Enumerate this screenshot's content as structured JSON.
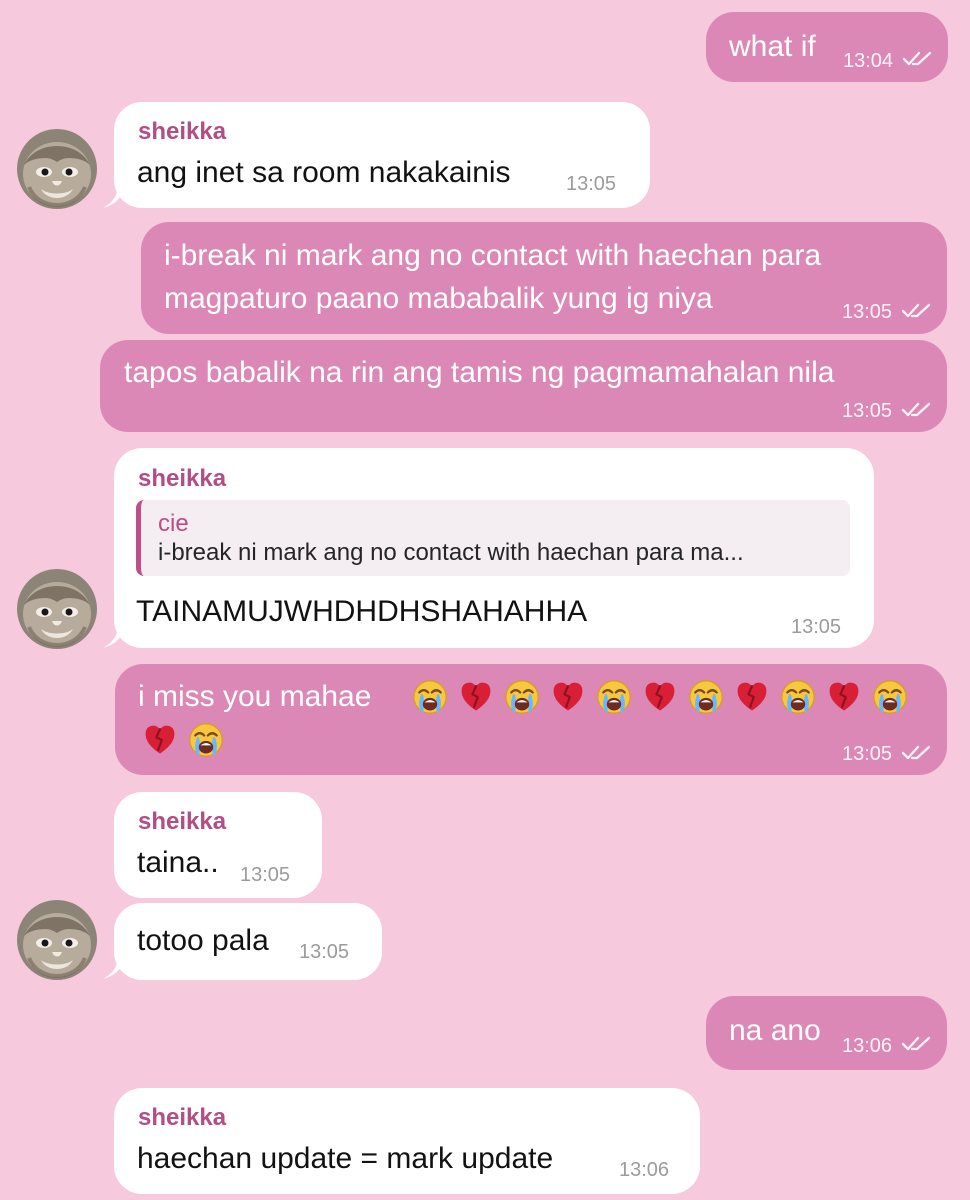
{
  "colors": {
    "background": "#f6c9dc",
    "incoming_bubble": "#ffffff",
    "outgoing_bubble": "#dc88b7",
    "sender_name": "#b24d86",
    "reply_bar": "#bf4d87"
  },
  "icons": {
    "read_receipt": "double-check-icon",
    "avatar": "profile-avatar",
    "crying_emoji": "loudly-crying-face-emoji",
    "broken_heart_emoji": "broken-heart-emoji"
  },
  "messages": [
    {
      "direction": "outgoing",
      "text": "what if",
      "time": "13:04",
      "read_receipt": "double-check-icon"
    },
    {
      "direction": "incoming",
      "sender": "sheikka",
      "text": "ang inet sa room nakakainis",
      "time": "13:05"
    },
    {
      "direction": "outgoing",
      "text_lines": [
        "i-break ni mark ang no contact with haechan para",
        "magpaturo paano mababalik yung ig niya"
      ],
      "time": "13:05",
      "read_receipt": "double-check-icon"
    },
    {
      "direction": "outgoing",
      "text": "tapos babalik na rin ang tamis ng pagmamahalan nila",
      "time": "13:05",
      "read_receipt": "double-check-icon"
    },
    {
      "direction": "incoming",
      "sender": "sheikka",
      "reply_to": {
        "name": "cie",
        "text": "i-break ni mark ang no contact with haechan para ma..."
      },
      "text": "TAINAMUJWHDHDHSHAHAHHA",
      "time": "13:05"
    },
    {
      "direction": "outgoing",
      "text": "i miss you mahae",
      "emoji_line1": [
        "sob",
        "broken_heart",
        "sob",
        "broken_heart",
        "sob",
        "broken_heart",
        "sob",
        "broken_heart",
        "sob",
        "broken_heart",
        "sob"
      ],
      "emoji_line2": [
        "broken_heart",
        "sob"
      ],
      "time": "13:05",
      "read_receipt": "double-check-icon"
    },
    {
      "direction": "incoming",
      "sender": "sheikka",
      "text": "taina..",
      "time": "13:05"
    },
    {
      "direction": "incoming",
      "text": "totoo pala",
      "time": "13:05"
    },
    {
      "direction": "outgoing",
      "text": "na ano",
      "time": "13:06",
      "read_receipt": "double-check-icon"
    },
    {
      "direction": "incoming",
      "sender": "sheikka",
      "text": "haechan update = mark update",
      "time": "13:06"
    }
  ]
}
